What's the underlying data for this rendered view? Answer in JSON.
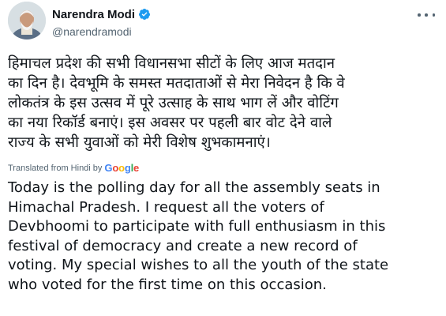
{
  "tweet": {
    "author": {
      "display_name": "Narendra Modi",
      "handle": "@narendramodi",
      "verified": true,
      "avatar_icon": "profile-photo"
    },
    "more_icon": "more-options-icon",
    "hindi_text": "हिमाचल प्रदेश की सभी विधानसभा सीटों के लिए आज मतदान\nका दिन है। देवभूमि के समस्त मतदाताओं से मेरा निवेदन है कि वे\nलोकतंत्र के इस उत्सव में पूरे उत्साह के साथ भाग लें और वोटिंग\nका नया रिकॉर्ड बनाएं। इस अवसर पर पहली बार वोट देने वाले\nराज्य के सभी युवाओं को मेरी विशेष शुभकामनाएं।",
    "translation": {
      "label": "Translated from Hindi by",
      "provider": "Google"
    },
    "english_text": "Today is the polling day for all the assembly seats in\nHimachal Pradesh. I request all the voters of\nDevbhoomi to participate with full enthusiasm in this\nfestival of democracy and create a new record of\nvoting. My special wishes to all the youth of the state\nwho voted for the first time on this occasion."
  },
  "colors": {
    "text_primary": "#0f1419",
    "text_secondary": "#536471",
    "verified_blue": "#1d9bf0",
    "google_blue": "#4285f4",
    "google_red": "#ea4335",
    "google_yellow": "#fbbc05",
    "google_green": "#34a853"
  }
}
